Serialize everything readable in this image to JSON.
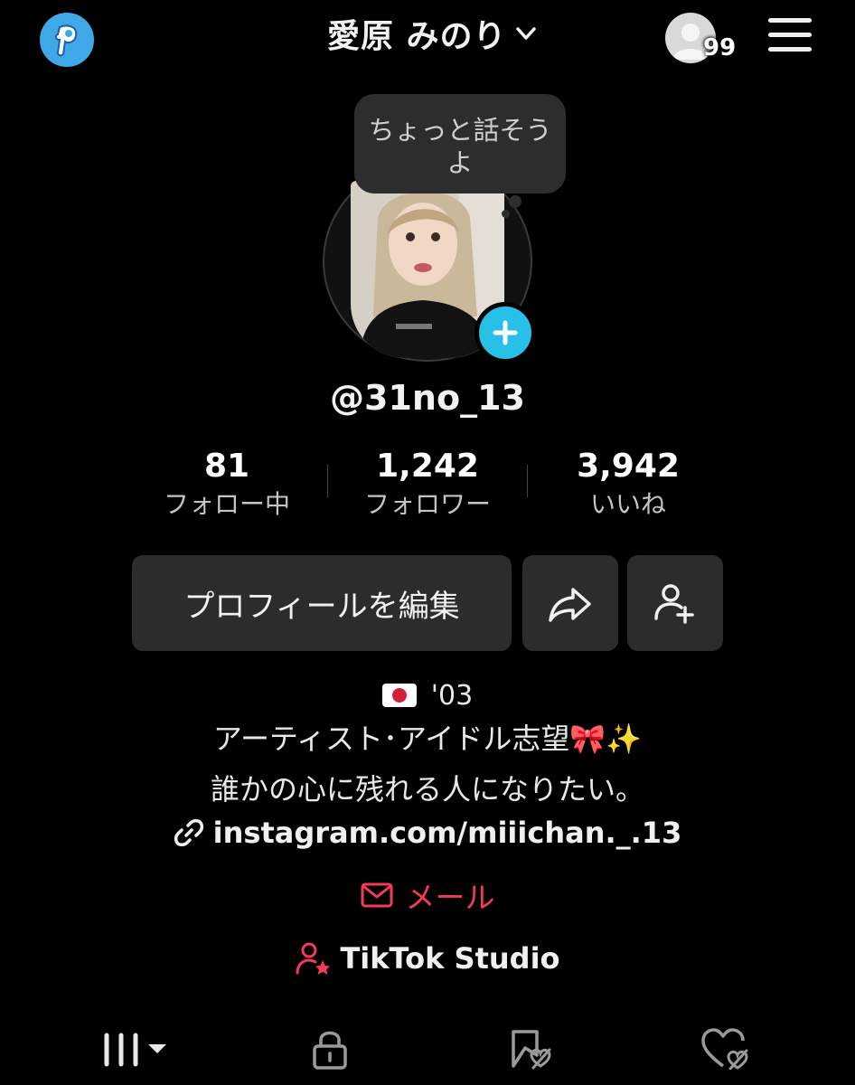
{
  "header": {
    "display_name": "愛原 みのり",
    "friends_badge_count": "99",
    "icons": [
      "app-badge-icon",
      "chevron-down-icon",
      "friends-avatar-icon",
      "menu-icon"
    ]
  },
  "profile": {
    "bubble_text": "ちょっと話そうよ",
    "username": "@31no_13"
  },
  "stats": [
    {
      "value": "81",
      "label": "フォロー中"
    },
    {
      "value": "1,242",
      "label": "フォロワー"
    },
    {
      "value": "3,942",
      "label": "いいね"
    }
  ],
  "actions": {
    "edit_label": "プロフィールを編集",
    "icons": [
      "share-icon",
      "add-friend-icon"
    ]
  },
  "bio": {
    "line1": "'03",
    "line2": "アーティスト･アイドル志望🎀✨",
    "line3": "誰かの心に残れる人になりたい。",
    "link": "instagram.com/miiichan._.13",
    "mail_label": "メール",
    "studio_label": "TikTok Studio"
  },
  "tabs": [
    "videos-grid-icon",
    "lock-icon",
    "favorites-icon",
    "liked-icon"
  ],
  "colors": {
    "background": "#000000",
    "accent_cyan": "#29c0e8",
    "mail_red": "#f23b5a",
    "button_bg": "#2c2c2c"
  }
}
